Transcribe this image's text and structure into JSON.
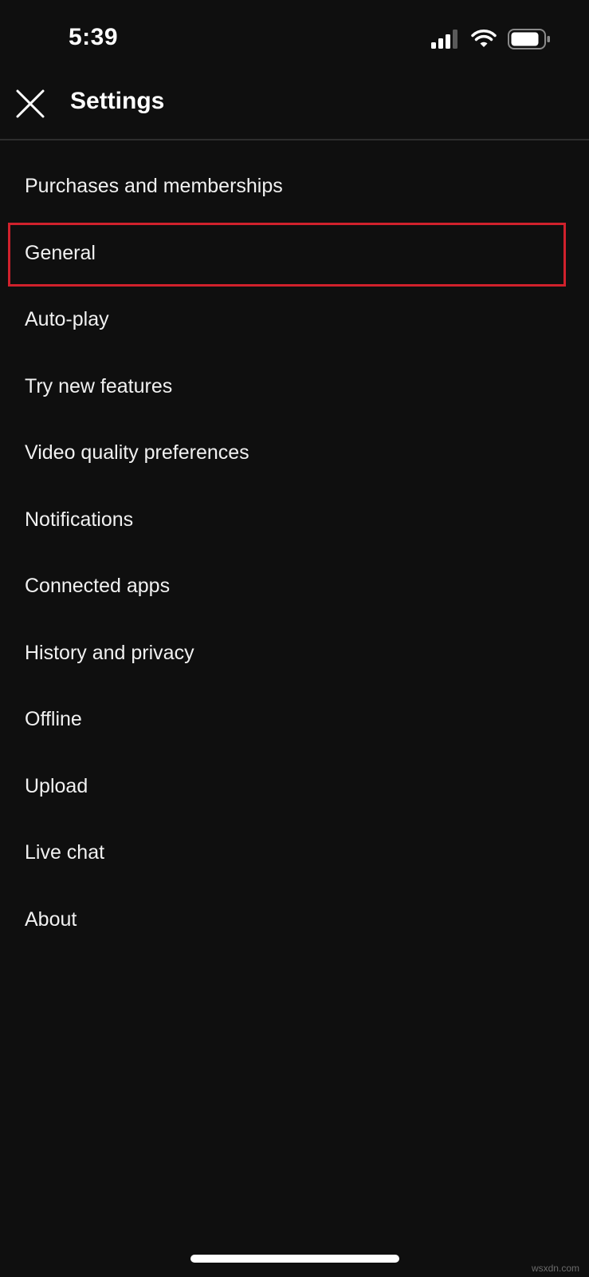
{
  "status_bar": {
    "time": "5:39",
    "icons": [
      "signal-icon",
      "wifi-icon",
      "battery-icon"
    ]
  },
  "header": {
    "title": "Settings",
    "close_icon": "close-icon"
  },
  "settings": {
    "items": [
      {
        "label": "Purchases and memberships"
      },
      {
        "label": "General",
        "highlighted": true
      },
      {
        "label": "Auto-play"
      },
      {
        "label": "Try new features"
      },
      {
        "label": "Video quality preferences"
      },
      {
        "label": "Notifications"
      },
      {
        "label": "Connected apps"
      },
      {
        "label": "History and privacy"
      },
      {
        "label": "Offline"
      },
      {
        "label": "Upload"
      },
      {
        "label": "Live chat"
      },
      {
        "label": "About"
      }
    ]
  },
  "watermark": "wsxdn.com",
  "colors": {
    "background": "#0f0f0f",
    "text": "#f1f1f1",
    "highlight_border": "#d0212c"
  }
}
